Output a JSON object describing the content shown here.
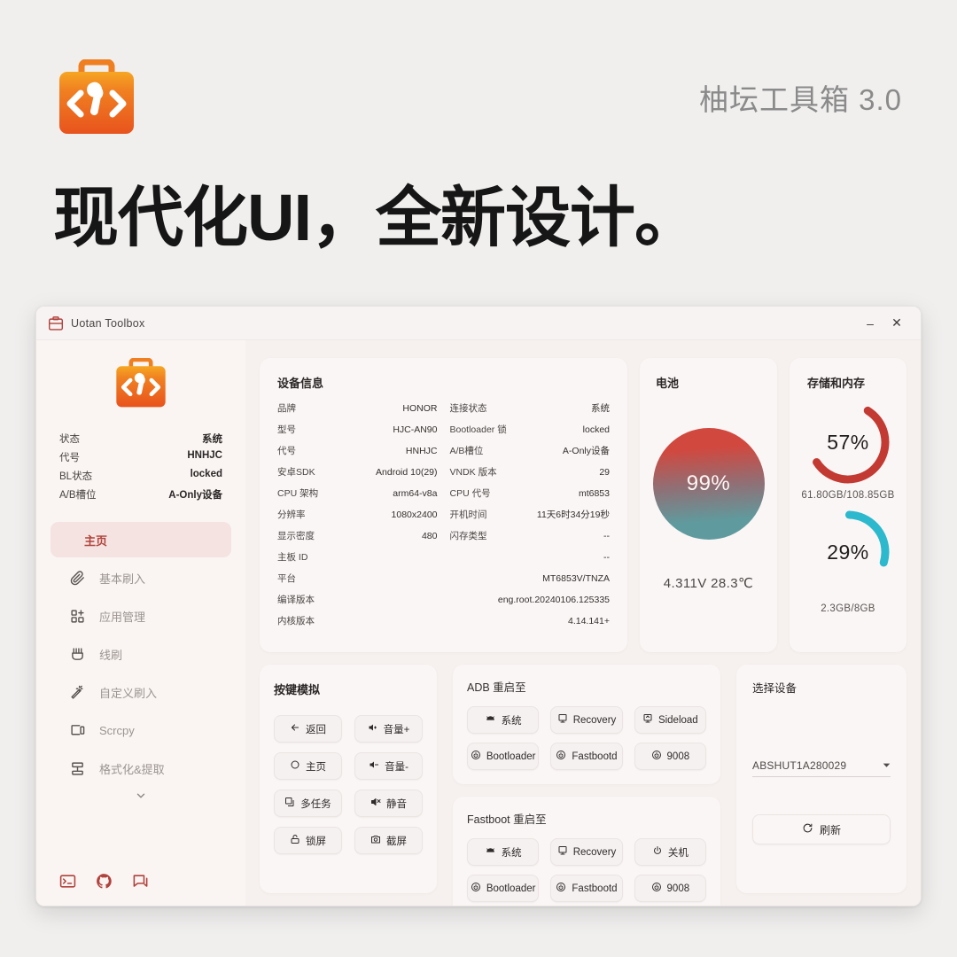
{
  "promo": {
    "product_name": "柚坛工具箱 3.0",
    "headline": "现代化UI，全新设计。",
    "logo_icon": "toolbox-icon"
  },
  "window": {
    "title": "Uotan Toolbox",
    "app_icon": "toolbox-icon",
    "minimize_label": "–",
    "close_label": "✕"
  },
  "sidebar": {
    "logo_icon": "toolbox-icon",
    "summary": [
      {
        "label": "状态",
        "value": "系统"
      },
      {
        "label": "代号",
        "value": "HNHJC"
      },
      {
        "label": "BL状态",
        "value": "locked"
      },
      {
        "label": "A/B槽位",
        "value": "A-Only设备"
      }
    ],
    "nav": [
      {
        "label": "主页",
        "icon": "home-icon",
        "active": true
      },
      {
        "label": "基本刷入",
        "icon": "flash-icon",
        "active": false
      },
      {
        "label": "应用管理",
        "icon": "apps-add-icon",
        "active": false
      },
      {
        "label": "线刷",
        "icon": "usb-cable-icon",
        "active": false
      },
      {
        "label": "自定义刷入",
        "icon": "magic-wand-icon",
        "active": false
      },
      {
        "label": "Scrcpy",
        "icon": "screen-mirror-icon",
        "active": false
      },
      {
        "label": "格式化&提取",
        "icon": "archive-extract-icon",
        "active": false
      }
    ],
    "expand_icon": "chevron-down-icon",
    "footer_icons": [
      "terminal-icon",
      "github-icon",
      "feedback-chat-icon"
    ]
  },
  "device_info": {
    "title": "设备信息",
    "left_rows": [
      {
        "label": "品牌",
        "value": "HONOR"
      },
      {
        "label": "型号",
        "value": "HJC-AN90"
      },
      {
        "label": "代号",
        "value": "HNHJC"
      },
      {
        "label": "安卓SDK",
        "value": "Android 10(29)"
      },
      {
        "label": "CPU 架构",
        "value": "arm64-v8a"
      },
      {
        "label": "分辨率",
        "value": "1080x2400"
      },
      {
        "label": "显示密度",
        "value": "480"
      }
    ],
    "right_rows": [
      {
        "label": "连接状态",
        "value": "系统"
      },
      {
        "label": "Bootloader 锁",
        "value": "locked"
      },
      {
        "label": "A/B槽位",
        "value": "A-Only设备"
      },
      {
        "label": "VNDK 版本",
        "value": "29"
      },
      {
        "label": "CPU 代号",
        "value": "mt6853"
      },
      {
        "label": "开机时间",
        "value": "11天6时34分19秒"
      },
      {
        "label": "闪存类型",
        "value": "--"
      }
    ],
    "wide_rows": [
      {
        "label": "主板 ID",
        "value": "--"
      },
      {
        "label": "平台",
        "value": "MT6853V/TNZA"
      },
      {
        "label": "编译版本",
        "value": "eng.root.20240106.125335"
      },
      {
        "label": "内核版本",
        "value": "4.14.141+"
      }
    ]
  },
  "battery": {
    "title": "电池",
    "percent": "99%",
    "stats": "4.311V 28.3℃",
    "gradient_top": "#d1483f",
    "gradient_bottom": "#5f9b9e"
  },
  "storage": {
    "title": "存储和内存",
    "storage_percent_label": "57%",
    "storage_percent_value": 57,
    "storage_caption": "61.80GB/108.85GB",
    "storage_color": "#c23a32",
    "memory_percent_label": "29%",
    "memory_percent_value": 29,
    "memory_caption": "2.3GB/8GB",
    "memory_color": "#2cb9cd"
  },
  "key_simulation": {
    "title": "按键模拟",
    "buttons": [
      {
        "label": "返回",
        "icon": "arrow-left-icon"
      },
      {
        "label": "音量+",
        "icon": "volume-up-icon"
      },
      {
        "label": "主页",
        "icon": "circle-icon"
      },
      {
        "label": "音量-",
        "icon": "volume-down-icon"
      },
      {
        "label": "多任务",
        "icon": "multitask-icon"
      },
      {
        "label": "静音",
        "icon": "volume-mute-icon"
      },
      {
        "label": "锁屏",
        "icon": "lock-icon"
      },
      {
        "label": "截屏",
        "icon": "camera-icon"
      }
    ]
  },
  "adb_reboot": {
    "title": "ADB 重启至",
    "buttons": [
      {
        "label": "系统",
        "icon": "android-icon"
      },
      {
        "label": "Recovery",
        "icon": "monitor-icon"
      },
      {
        "label": "Sideload",
        "icon": "monitor-arrow-icon"
      },
      {
        "label": "Bootloader",
        "icon": "power-circle-icon"
      },
      {
        "label": "Fastbootd",
        "icon": "power-circle-icon"
      },
      {
        "label": "9008",
        "icon": "power-circle-icon"
      }
    ]
  },
  "fastboot_reboot": {
    "title": "Fastboot 重启至",
    "buttons": [
      {
        "label": "系统",
        "icon": "android-icon"
      },
      {
        "label": "Recovery",
        "icon": "monitor-icon"
      },
      {
        "label": "关机",
        "icon": "power-icon"
      },
      {
        "label": "Bootloader",
        "icon": "power-circle-icon"
      },
      {
        "label": "Fastbootd",
        "icon": "power-circle-icon"
      },
      {
        "label": "9008",
        "icon": "power-circle-icon"
      }
    ]
  },
  "device_select": {
    "title": "选择设备",
    "selected_value": "ABSHUT1A280029",
    "caret_icon": "chevron-down-icon",
    "refresh_label": "刷新",
    "refresh_icon": "refresh-icon"
  }
}
